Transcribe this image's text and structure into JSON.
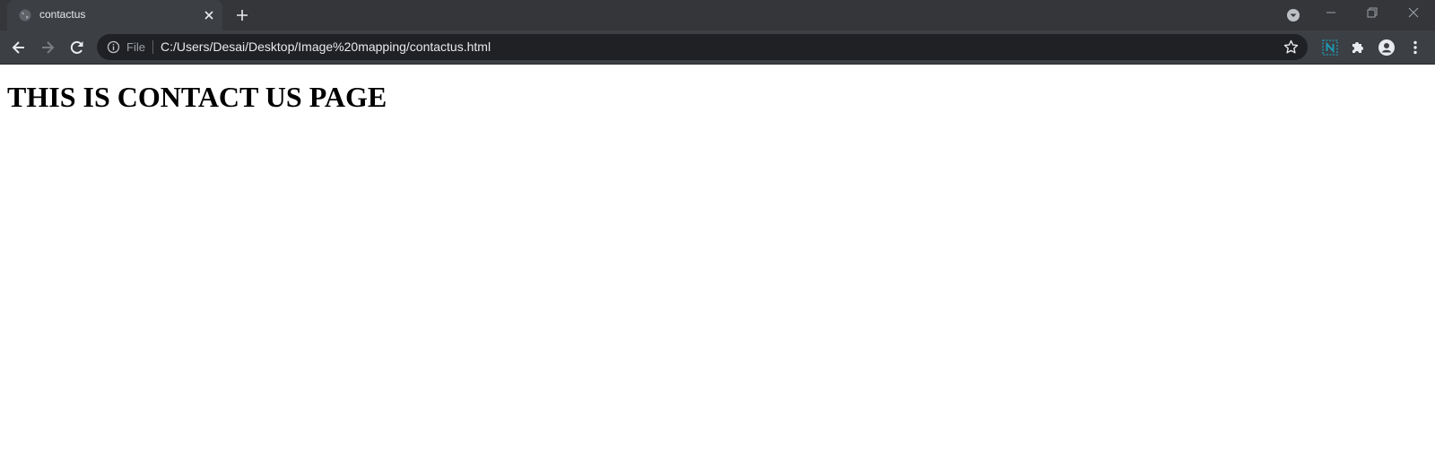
{
  "tab": {
    "title": "contactus",
    "favicon": "globe-icon"
  },
  "address_bar": {
    "scheme": "File",
    "url": "C:/Users/Desai/Desktop/Image%20mapping/contactus.html"
  },
  "page": {
    "heading": "THIS IS CONTACT US PAGE"
  },
  "colors": {
    "titlebar": "#35363a",
    "toolbar": "#3c3f44",
    "omnibox": "#202124",
    "extension_accent": "#1e9bb5"
  },
  "icons": [
    "back-icon",
    "forward-icon",
    "reload-icon",
    "info-icon",
    "star-icon",
    "extension-n-icon",
    "puzzle-icon",
    "profile-icon",
    "menu-icon"
  ]
}
